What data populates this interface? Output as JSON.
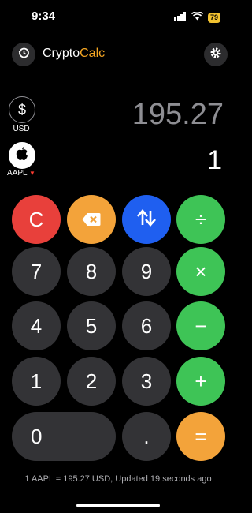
{
  "status_bar": {
    "time": "9:34",
    "battery": "79"
  },
  "header": {
    "title_main": "Crypto",
    "title_accent": "Calc"
  },
  "from_currency": {
    "label": "USD",
    "symbol": "$",
    "value": "195.27"
  },
  "to_currency": {
    "label": "AAPL",
    "symbol": "",
    "value": "1"
  },
  "keys": {
    "clear": "C",
    "divide": "÷",
    "seven": "7",
    "eight": "8",
    "nine": "9",
    "multiply": "×",
    "four": "4",
    "five": "5",
    "six": "6",
    "minus": "−",
    "one": "1",
    "two": "2",
    "three": "3",
    "plus": "+",
    "zero": "0",
    "decimal": ".",
    "equals": "="
  },
  "footer": "1 AAPL = 195.27 USD, Updated 19 seconds ago",
  "colors": {
    "accent": "#f5a623",
    "clear": "#e8403b",
    "backspace": "#f3a33a",
    "swap": "#1f5ff0",
    "operator": "#3ec456"
  }
}
